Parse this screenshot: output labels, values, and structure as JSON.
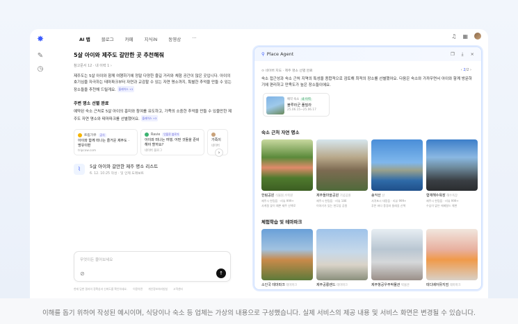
{
  "nav": {
    "tabs": [
      "AI 탭",
      "블로그",
      "카페",
      "지식iN",
      "동영상"
    ],
    "more": "···"
  },
  "chat": {
    "title": "5살 아이와 제주도 갈만한 곳 추천해줘",
    "meta": "참고문서 12 · 내 이력 1 ›",
    "para1": "제주도는 5살 아이와 함께 여행하기에 정말 다양한 즐길 거리와 체험 공간이 많은 곳입니다. 아이의 호기심을 자극하는 테마파크부터 자연과 교감할 수 있는 자연 명소까지, 특별한 추억을 만들 수 있는 장소들을 추천해 드릴게요.",
    "cite1": "플레이스 +2",
    "section": "주변 명소 선별 완료",
    "para2": "예약된 숙소 근처로 5살 아이의 흥미와 참여를 유도하고, 가족의 소중한 추억을 만들 수 있을만한 제주도 자연 명소와 테마파크를 선별했어요.",
    "cite2": "플레이스 +3",
    "cards": [
      {
        "source": "트립가우",
        "tag": "공식",
        "title": "아이와 함께 떠나는 즐거운 제주도 · 명유이편",
        "sub": "tripcow.com"
      },
      {
        "source": "Ravie",
        "tag": "인플루 블로거",
        "title": "아이와 떠나는 여행, 어떤 것들을 준비해야 할까요?",
        "sub": "네이버 블로그"
      },
      {
        "source": "",
        "tag": "",
        "title": "가족이",
        "sub": "네이버"
      }
    ],
    "list_item": {
      "title": "5살 아이와 갈만한 제주 명소 리스트",
      "sub": "6. 12. 10:25 작성 · 및 인제 도래보트"
    },
    "input_placeholder": "무엇이든 물어보세요",
    "footer": [
      "현재 답변 결과의 정확성과 신뢰도를 확인하세요.",
      "이용약관",
      "개인정보처리방침",
      "고객센터"
    ]
  },
  "agent": {
    "title": "Place Agent",
    "crumb": "네이버 지도  ·  제주 명소 선별 완료",
    "pager": {
      "current": "2",
      "sep": "/",
      "total": "2"
    },
    "desc": "숙소 접근성과 숙소 근처 지역의 특성을 종합적으로 검토해 최적의 장소를 선별했어요. 다음은 숙소와 가까우면서 아이와 함께 방문하기에 편리하고 만족도가 높은 장소들이에요.",
    "booking": {
      "label": "예약 숙소",
      "badge": "내 이력",
      "name": "블루라군 풀빌라",
      "dates": "25.06.15~25.06.17"
    },
    "section1": "숙소 근처 자연 명소",
    "nature": [
      {
        "name": "한림공원",
        "type": "식물원,수목원",
        "l2": "제주시 한림읍 · 리뷰 999+",
        "l3": "사계절 꽃이 예쁜 제주 산책로"
      },
      {
        "name": "제주돌마을공원",
        "type": "기념공원",
        "l2": "제주시 한림읍 · 리뷰 186",
        "l3": "이야기가 있는 현무암 공원"
      },
      {
        "name": "송악산",
        "type": "산",
        "l2": "서귀포시 대정읍 · 리뷰 999+",
        "l3": "푸른 바다 풍경과 둘레길 산책"
      },
      {
        "name": "협재해수욕장",
        "type": "해수욕장",
        "l2": "제주시 한림읍 · 리뷰 999+",
        "l3": "수심이 얕은 에메랄드 해변"
      }
    ],
    "section2": "체험학습 및 테마파크",
    "theme": [
      {
        "name": "소인국 테마파크",
        "type": "테마파크"
      },
      {
        "name": "제주공룡랜드",
        "type": "테마파크"
      },
      {
        "name": "제주항공우주박물관",
        "type": "박물관"
      },
      {
        "name": "테디베어뮤지엄",
        "type": "테마파크"
      }
    ]
  },
  "caption": "이해를 돕기 위하여 작성된 예시이며, 식당이나 숙소 등 업체는 가상의 내용으로 구성했습니다. 실제 서비스의 제공 내용 및 서비스 화면은 변경될 수 있습니다."
}
